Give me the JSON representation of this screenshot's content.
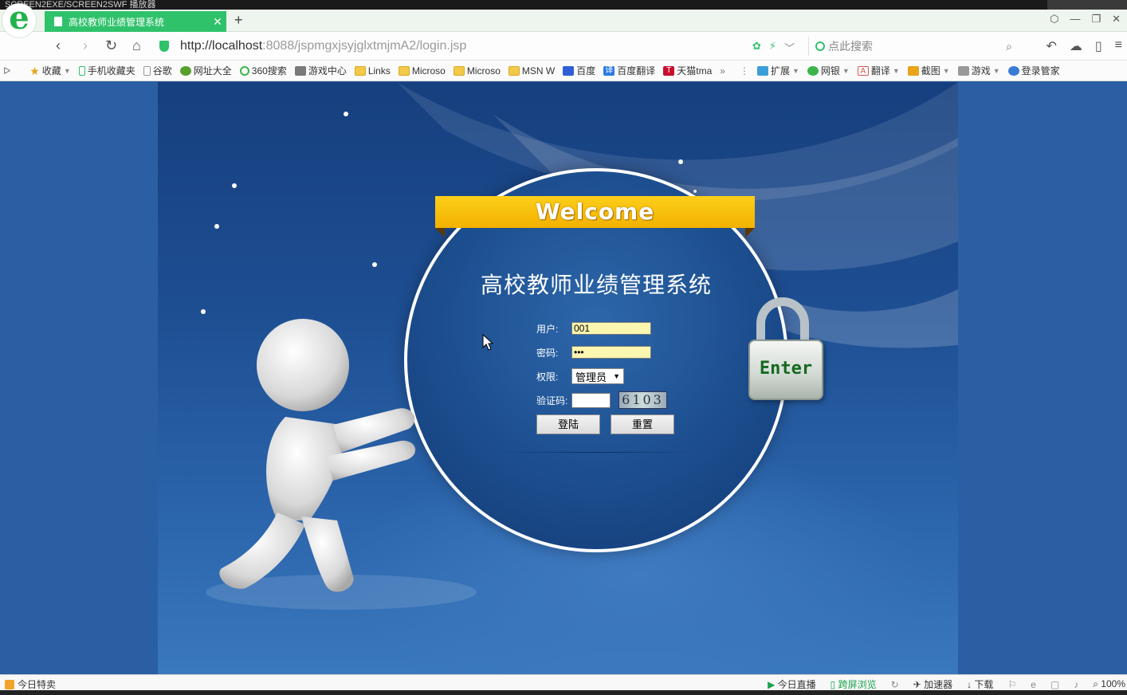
{
  "window": {
    "title": "SCREEN2EXE/SCREEN2SWF 播放器"
  },
  "browser": {
    "logo_glyph": "e",
    "tab": {
      "title": "高校教师业绩管理系统",
      "close": "✕"
    },
    "new_tab": "+",
    "window_controls": [
      "⬡",
      "—",
      "❐",
      "✕"
    ],
    "nav": {
      "back": "‹",
      "forward": "›",
      "refresh": "↻",
      "home": "⌂"
    },
    "address": {
      "host": "http://localhost",
      "path": ":8088/jspmgxjsyjglxtmjmA2/login.jsp"
    },
    "address_icons": [
      "✿",
      "⚡",
      "﹀"
    ],
    "search": {
      "placeholder": "点此搜索",
      "icon": "⌕"
    },
    "toolbar_icons": [
      "↶",
      "☁",
      "▯",
      "≡"
    ],
    "bookmarks": [
      {
        "icon": "star",
        "label": "收藏"
      },
      {
        "icon": "phone",
        "label": "手机收藏夹"
      },
      {
        "icon": "page",
        "label": "谷歌"
      },
      {
        "icon": "site",
        "label": "网址大全"
      },
      {
        "icon": "360",
        "label": "360搜索"
      },
      {
        "icon": "game",
        "label": "游戏中心"
      },
      {
        "icon": "folder",
        "label": "Links"
      },
      {
        "icon": "folder",
        "label": "Microso"
      },
      {
        "icon": "folder",
        "label": "Microso"
      },
      {
        "icon": "folder",
        "label": "MSN W"
      },
      {
        "icon": "baidu",
        "label": "百度"
      },
      {
        "icon": "translate",
        "label": "百度翻译"
      },
      {
        "icon": "tmall",
        "label": "天猫tma"
      },
      {
        "icon": "more",
        "label": "»"
      },
      {
        "icon": "ext",
        "label": "扩展"
      },
      {
        "icon": "bank",
        "label": "网银"
      },
      {
        "icon": "trans",
        "label": "翻译"
      },
      {
        "icon": "shot",
        "label": "截图"
      },
      {
        "icon": "gamepad",
        "label": "游戏"
      },
      {
        "icon": "login",
        "label": "登录管家"
      }
    ],
    "status": {
      "left": "今日特卖",
      "right": [
        "今日直播",
        "跨屏浏览",
        "加速器",
        "下载",
        "100%"
      ]
    }
  },
  "login": {
    "welcome": "Welcome",
    "system_title": "高校教师业绩管理系统",
    "user_label": "用户:",
    "user_value": "001",
    "password_label": "密码:",
    "password_value": "•••",
    "role_label": "权限:",
    "role_value": "管理员",
    "captcha_label": "验证码:",
    "captcha_input": "",
    "captcha_code": "6103",
    "login_button": "登陆",
    "reset_button": "重置",
    "enter_label": "Enter"
  },
  "colors": {
    "tab_green": "#2fc26b",
    "ribbon_yellow": "#f5bd06",
    "stage_blue": "#1e4f93",
    "input_yellow": "#fbf7b0",
    "enter_green": "#156a1f"
  }
}
